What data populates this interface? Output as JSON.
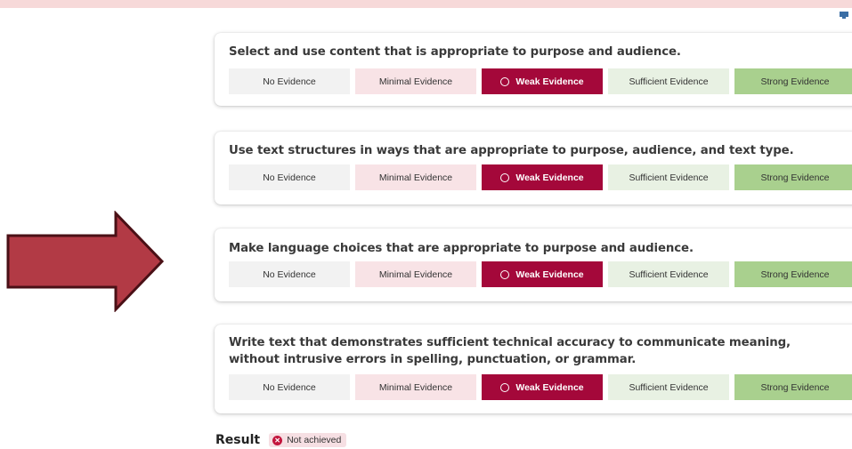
{
  "colors": {
    "accent": "#a4083a",
    "arrow_fill": "#b23a45",
    "arrow_stroke": "#4a1016",
    "minimal_bg": "#f8e3e6",
    "sufficient_bg": "#e8f1e3",
    "strong_bg": "#a9d08e",
    "no_evidence_bg": "#f2f2f2"
  },
  "icons": {
    "corner": "monitor-icon",
    "pointer": "arrow-right-icon",
    "status": "x-circle-icon"
  },
  "criteria": [
    {
      "title": "Select and use content that is appropriate to purpose and audience.",
      "selected": "Weak Evidence",
      "options": [
        "No Evidence",
        "Minimal Evidence",
        "Weak Evidence",
        "Sufficient Evidence",
        "Strong Evidence"
      ]
    },
    {
      "title": "Use text structures in ways that are appropriate to purpose, audience, and text type.",
      "selected": "Weak Evidence",
      "options": [
        "No Evidence",
        "Minimal Evidence",
        "Weak Evidence",
        "Sufficient Evidence",
        "Strong Evidence"
      ]
    },
    {
      "title": "Make language choices that are appropriate to purpose and audience.",
      "selected": "Weak Evidence",
      "options": [
        "No Evidence",
        "Minimal Evidence",
        "Weak Evidence",
        "Sufficient Evidence",
        "Strong Evidence"
      ]
    },
    {
      "title": "Write text that demonstrates sufficient technical accuracy to communicate meaning, without intrusive errors in spelling, punctuation, or grammar.",
      "selected": "Weak Evidence",
      "options": [
        "No Evidence",
        "Minimal Evidence",
        "Weak Evidence",
        "Sufficient Evidence",
        "Strong Evidence"
      ]
    }
  ],
  "result": {
    "label": "Result",
    "status": "Not achieved"
  }
}
